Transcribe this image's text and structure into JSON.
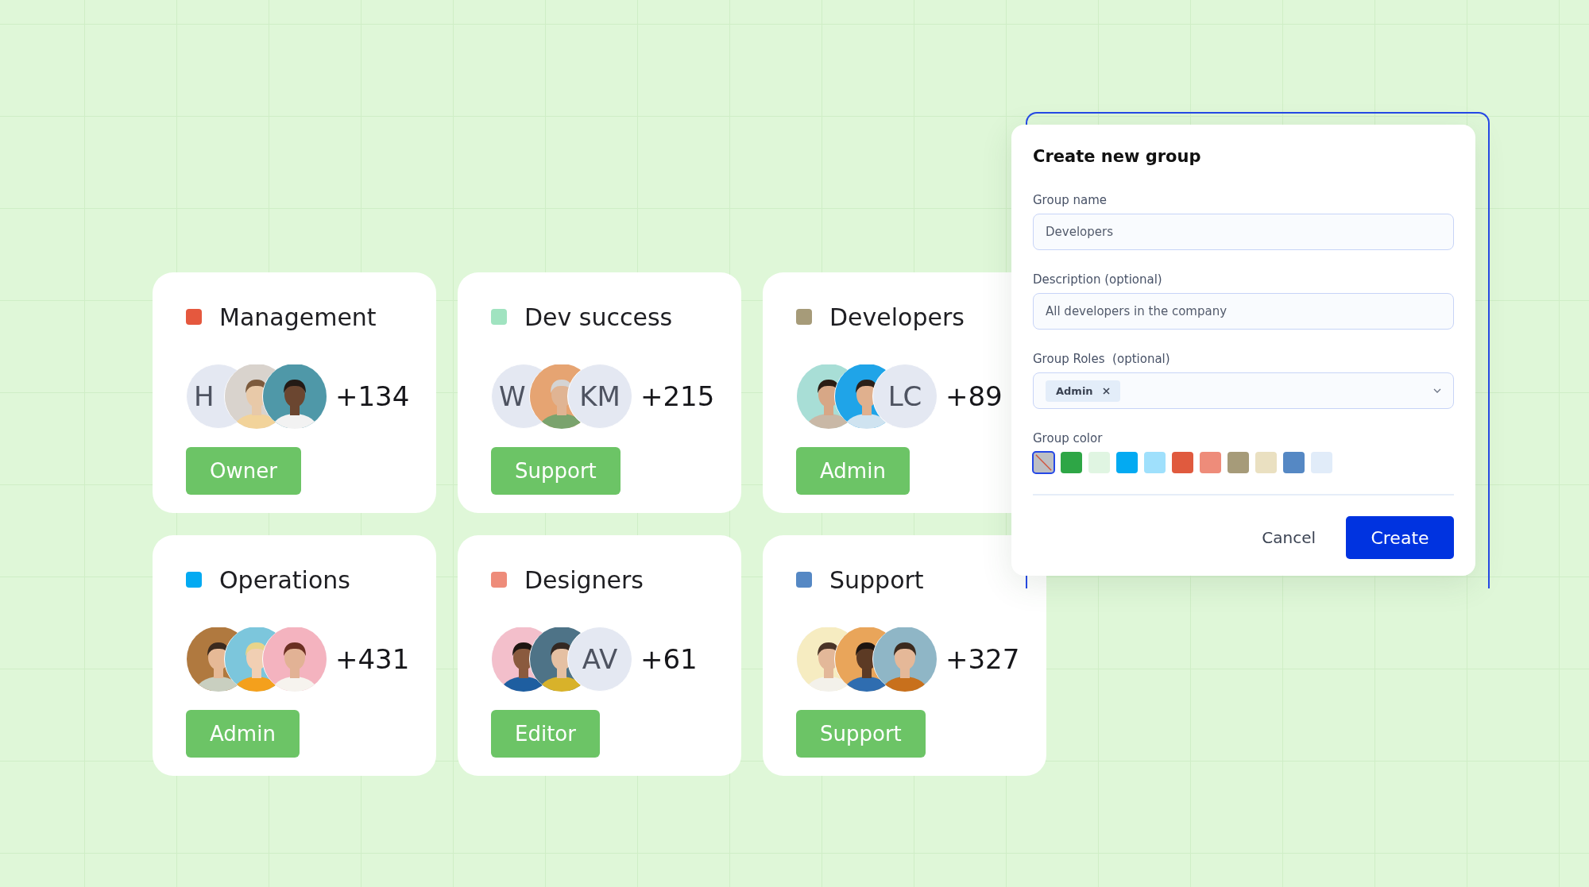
{
  "groups": [
    {
      "name": "Management",
      "color": "#e5583e",
      "members": [
        {
          "kind": "initials",
          "text": "H"
        },
        {
          "kind": "picture"
        },
        {
          "kind": "picture"
        }
      ],
      "count": "+134",
      "role": "Owner"
    },
    {
      "name": "Dev success",
      "color": "#a0e3c0",
      "members": [
        {
          "kind": "initials",
          "text": "W"
        },
        {
          "kind": "picture"
        },
        {
          "kind": "initials",
          "text": "KM"
        }
      ],
      "count": "+215",
      "role": "Support"
    },
    {
      "name": "Developers",
      "color": "#a69b79",
      "members": [
        {
          "kind": "picture"
        },
        {
          "kind": "picture"
        },
        {
          "kind": "initials",
          "text": "LC"
        }
      ],
      "count": "+89",
      "role": "Admin"
    },
    {
      "name": "Operations",
      "color": "#03aaf2",
      "members": [
        {
          "kind": "picture"
        },
        {
          "kind": "picture"
        },
        {
          "kind": "picture"
        }
      ],
      "count": "+431",
      "role": "Admin"
    },
    {
      "name": "Designers",
      "color": "#ee8c7a",
      "members": [
        {
          "kind": "picture"
        },
        {
          "kind": "picture"
        },
        {
          "kind": "initials",
          "text": "AV"
        }
      ],
      "count": "+61",
      "role": "Editor"
    },
    {
      "name": "Support",
      "color": "#5588c4",
      "members": [
        {
          "kind": "picture"
        },
        {
          "kind": "picture"
        },
        {
          "kind": "picture"
        }
      ],
      "count": "+327",
      "role": "Support"
    }
  ],
  "dialog": {
    "title": "Create new group",
    "group_name": {
      "label": "Group name",
      "value": "Developers"
    },
    "description": {
      "label": "Description (optional)",
      "value": "All developers in the company"
    },
    "roles": {
      "label": "Group Roles  (optional)",
      "chips": [
        "Admin"
      ]
    },
    "group_color": {
      "label": "Group color",
      "swatches": [
        {
          "kind": "none",
          "color": "#bdbfc3",
          "selected": true
        },
        {
          "kind": "color",
          "color": "#2ea646",
          "selected": false
        },
        {
          "kind": "color",
          "color": "#e0f5e2",
          "selected": false
        },
        {
          "kind": "color",
          "color": "#03aaf2",
          "selected": false
        },
        {
          "kind": "color",
          "color": "#9fe0fc",
          "selected": false
        },
        {
          "kind": "color",
          "color": "#e05a3e",
          "selected": false
        },
        {
          "kind": "color",
          "color": "#ee8c7a",
          "selected": false
        },
        {
          "kind": "color",
          "color": "#a69b79",
          "selected": false
        },
        {
          "kind": "color",
          "color": "#eae0c1",
          "selected": false
        },
        {
          "kind": "color",
          "color": "#5588c4",
          "selected": false
        },
        {
          "kind": "color",
          "color": "#e1ecf9",
          "selected": false
        }
      ]
    },
    "buttons": {
      "cancel": "Cancel",
      "create": "Create"
    }
  }
}
